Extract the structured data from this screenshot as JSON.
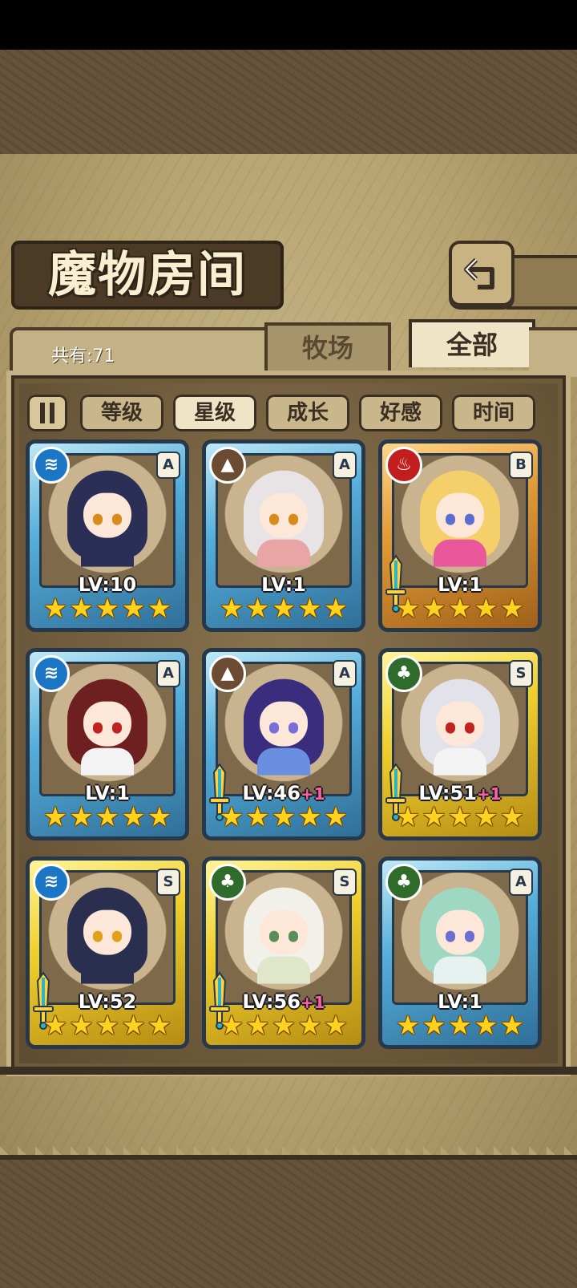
{
  "header": {
    "title": "魔物房间",
    "back_icon": "return-arrow-icon"
  },
  "tabs": {
    "count_label": "共有:71",
    "farm": "牧场",
    "all": "全部",
    "active": "全部"
  },
  "filters": {
    "sort_icon": "sort-toggle-icon",
    "items": [
      "等级",
      "星级",
      "成长",
      "好感",
      "时间"
    ],
    "active": "星级"
  },
  "monsters": [
    {
      "element": "water",
      "rank": "A",
      "level": "LV:10",
      "bonus": "",
      "stars": 5,
      "frame": "blue",
      "sword": false,
      "hair": "#2b2f55",
      "eyes": "#d98a1c",
      "outfit": "#2b2f55"
    },
    {
      "element": "earth",
      "rank": "A",
      "level": "LV:1",
      "bonus": "",
      "stars": 5,
      "frame": "blue",
      "sword": false,
      "hair": "#e8e4e6",
      "eyes": "#d98a1c",
      "outfit": "#e8a5a5"
    },
    {
      "element": "fire",
      "rank": "B",
      "level": "LV:1",
      "bonus": "",
      "stars": 5,
      "frame": "orange",
      "sword": true,
      "hair": "#f5cf6a",
      "eyes": "#5a6fd1",
      "outfit": "#e8589a"
    },
    {
      "element": "water",
      "rank": "A",
      "level": "LV:1",
      "bonus": "",
      "stars": 5,
      "frame": "blue",
      "sword": false,
      "hair": "#6e1f1f",
      "eyes": "#c12222",
      "outfit": "#f3f3f3"
    },
    {
      "element": "earth",
      "rank": "A",
      "level": "LV:46",
      "bonus": "+1",
      "stars": 5,
      "frame": "blue",
      "sword": true,
      "hair": "#3b2d7d",
      "eyes": "#7a6fd9",
      "outfit": "#6b8fe0"
    },
    {
      "element": "wood",
      "rank": "S",
      "level": "LV:51",
      "bonus": "+1",
      "stars": 5,
      "frame": "gold",
      "sword": true,
      "hair": "#e2e2ea",
      "eyes": "#c12222",
      "outfit": "#f3f3f3"
    },
    {
      "element": "water",
      "rank": "S",
      "level": "LV:52",
      "bonus": "",
      "stars": 5,
      "frame": "gold",
      "sword": true,
      "hair": "#2a2f4f",
      "eyes": "#e0a21a",
      "outfit": "#2a2f4f"
    },
    {
      "element": "wood",
      "rank": "S",
      "level": "LV:56",
      "bonus": "+1",
      "stars": 5,
      "frame": "gold",
      "sword": true,
      "hair": "#f1f1ea",
      "eyes": "#5b8d5b",
      "outfit": "#dfe6c9"
    },
    {
      "element": "wood",
      "rank": "A",
      "level": "LV:1",
      "bonus": "",
      "stars": 5,
      "frame": "blue",
      "sword": false,
      "hair": "#9fd8c2",
      "eyes": "#6a6fd1",
      "outfit": "#e6f2f0"
    }
  ]
}
